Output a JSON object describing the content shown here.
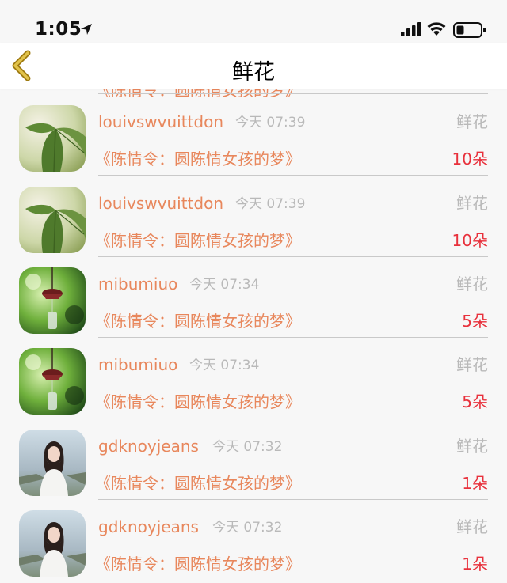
{
  "status_bar": {
    "time": "1:05"
  },
  "nav": {
    "title": "鲜花"
  },
  "partial_row": {
    "username": "《陈情令：圆陈情女孩的梦》"
  },
  "rows": [
    {
      "username": "louivswvuittdon",
      "time": "今天 07:39",
      "type": "鲜花",
      "title": "《陈情令：圆陈情女孩的梦》",
      "count": "10朵",
      "avatar": "leaf"
    },
    {
      "username": "louivswvuittdon",
      "time": "今天 07:39",
      "type": "鲜花",
      "title": "《陈情令：圆陈情女孩的梦》",
      "count": "10朵",
      "avatar": "leaf"
    },
    {
      "username": "mibumiuo",
      "time": "今天 07:34",
      "type": "鲜花",
      "title": "《陈情令：圆陈情女孩的梦》",
      "count": "5朵",
      "avatar": "wind-chime"
    },
    {
      "username": "mibumiuo",
      "time": "今天 07:34",
      "type": "鲜花",
      "title": "《陈情令：圆陈情女孩的梦》",
      "count": "5朵",
      "avatar": "wind-chime"
    },
    {
      "username": "gdknoyjeans",
      "time": "今天 07:32",
      "type": "鲜花",
      "title": "《陈情令：圆陈情女孩的梦》",
      "count": "1朵",
      "avatar": "girl-portrait"
    },
    {
      "username": "gdknoyjeans",
      "time": "今天 07:32",
      "type": "鲜花",
      "title": "《陈情令：圆陈情女孩的梦》",
      "count": "1朵",
      "avatar": "girl-portrait"
    }
  ],
  "colors": {
    "accent": "#e8875c",
    "count": "#e8313c",
    "muted": "#b9b9b9",
    "back_arrow": "#c9a227"
  }
}
